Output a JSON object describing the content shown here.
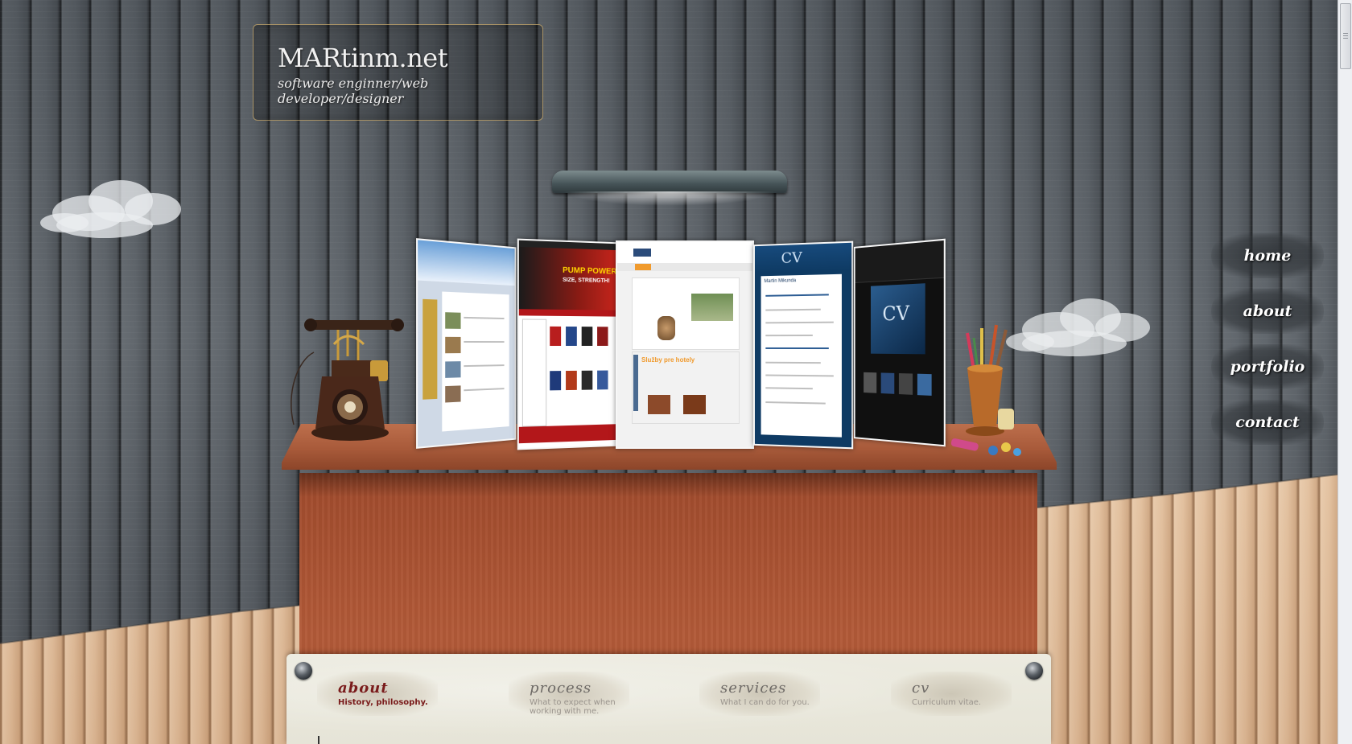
{
  "site": {
    "title": "MARtinm.net",
    "subtitle": "software enginner/web developer/designer"
  },
  "nav": {
    "items": [
      {
        "label": "home"
      },
      {
        "label": "about"
      },
      {
        "label": "portfolio"
      },
      {
        "label": "contact"
      }
    ]
  },
  "tabs": [
    {
      "title": "about",
      "desc": "History, philosophy.",
      "active": true
    },
    {
      "title": "process",
      "desc": "What to expect when working with me.",
      "active": false
    },
    {
      "title": "services",
      "desc": "What I can do for you.",
      "active": false
    },
    {
      "title": "cv",
      "desc": "Curriculum vitae.",
      "active": false
    }
  ],
  "portfolio_thumbs": [
    {
      "name": "travel-site"
    },
    {
      "name": "pump-power-shop",
      "headline": "PUMP POWER",
      "tagline": "SIZE, STRENGTH!"
    },
    {
      "name": "webstudio-site",
      "headline": "Služby pre hotely"
    },
    {
      "name": "cv-site",
      "headline": "CV",
      "person": "Martin Mikunda"
    },
    {
      "name": "dark-portfolio-site",
      "headline": "CV"
    }
  ],
  "colors": {
    "accent": "#7a1b1b",
    "plank": "#555b61",
    "fence": "#dcb896",
    "desk": "#a8522f"
  }
}
